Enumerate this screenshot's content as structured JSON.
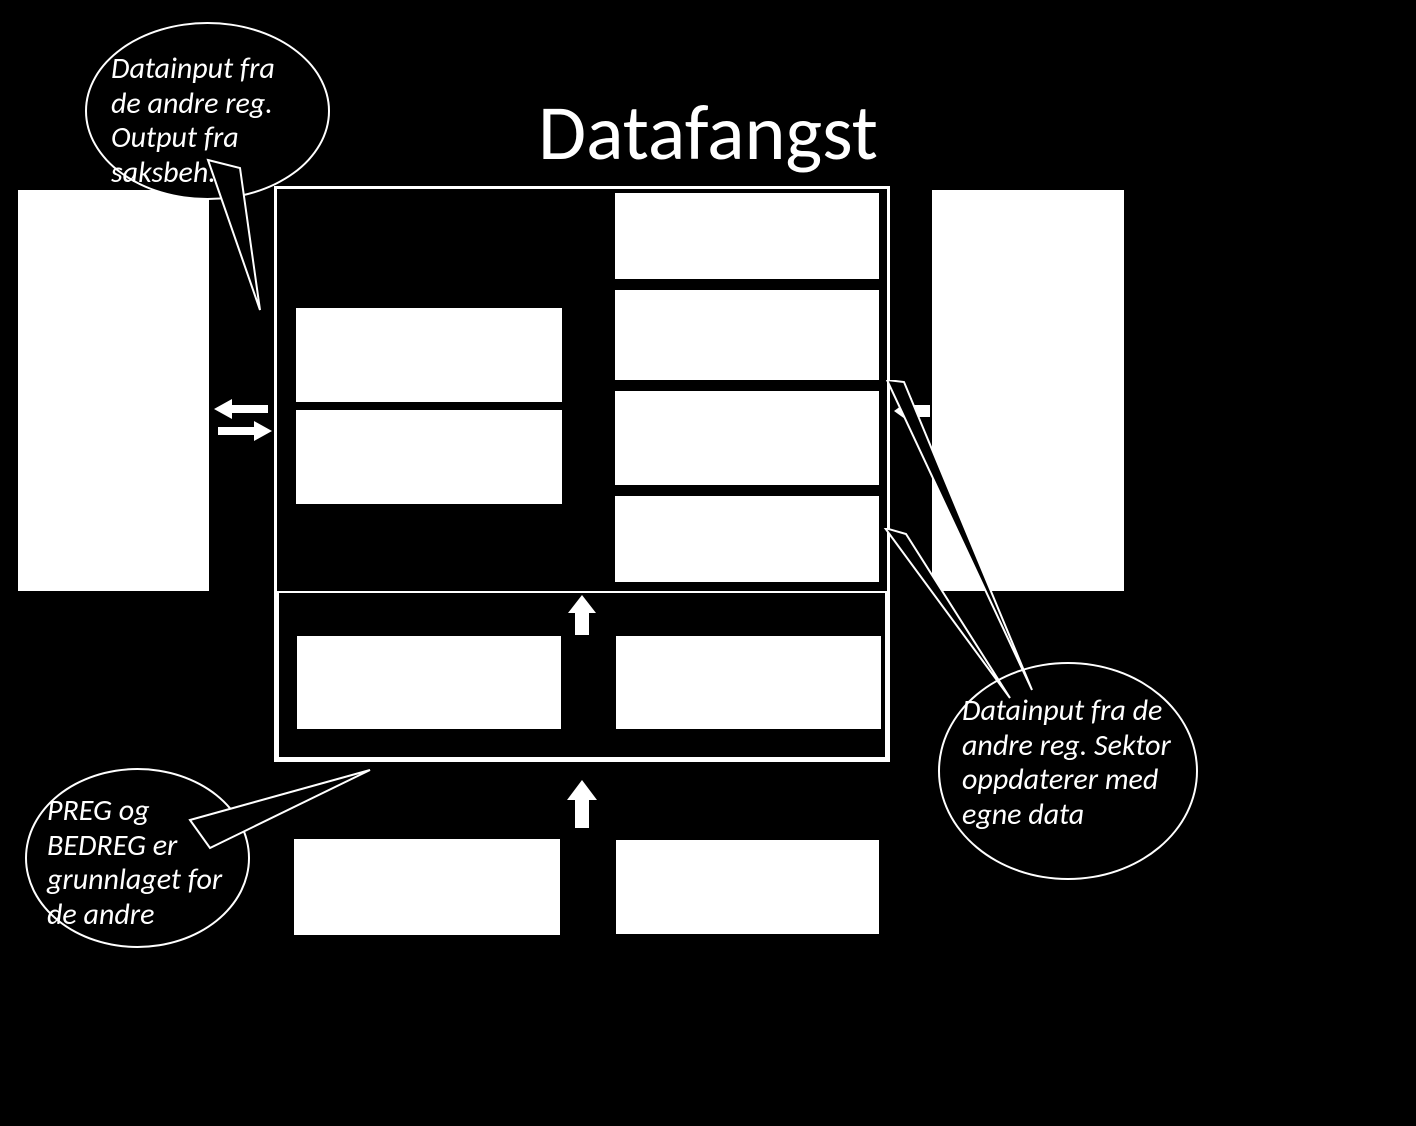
{
  "title": "Datafangst",
  "callouts": {
    "top_left": "Datainput fra de andre reg. Output fra saksbeh.",
    "bottom_left": "PREG og BEDREG er grunnlaget for de andre",
    "bottom_right": "Datainput fra de andre reg. Sektor oppdaterer med egne data"
  }
}
